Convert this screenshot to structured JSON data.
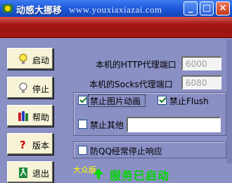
{
  "window": {
    "title": "动感大挪移",
    "watermark": "www.youxiaxiazai.com",
    "controls": {
      "minimize": "_",
      "maximize": "□",
      "close": "×"
    }
  },
  "sidebar": {
    "buttons": [
      {
        "label": "启动",
        "icon": "lightbulb-on-icon"
      },
      {
        "label": "停止",
        "icon": "lightbulb-off-icon"
      },
      {
        "label": "帮助",
        "icon": "books-icon"
      },
      {
        "label": "版本",
        "icon": "question-icon"
      },
      {
        "label": "退出",
        "icon": "exit-door-icon"
      }
    ]
  },
  "settings": {
    "http_proxy_label": "本机的HTTP代理端口",
    "http_proxy_port": "6000",
    "socks_proxy_label": "本机的Socks代理端口",
    "socks_proxy_port": "6080",
    "block_image_anim_label": "禁止图片动画",
    "block_image_anim_checked": true,
    "block_flush_label": "禁止Flush",
    "block_flush_checked": true,
    "block_other_label": "禁止其他",
    "block_other_checked": false,
    "block_other_value": "",
    "qq_stop_label": "防QQ经常停止响应",
    "qq_stop_checked": false
  },
  "status": {
    "edition": "大众版",
    "message": "服务已启动"
  },
  "colors": {
    "background": "#8a8fc4",
    "title_bar": "#1a55d8",
    "header_strip": "#b71d1d",
    "button_face": "#f7f3d6",
    "status_green": "#00d800",
    "edition_yellow": "#ffff00"
  }
}
